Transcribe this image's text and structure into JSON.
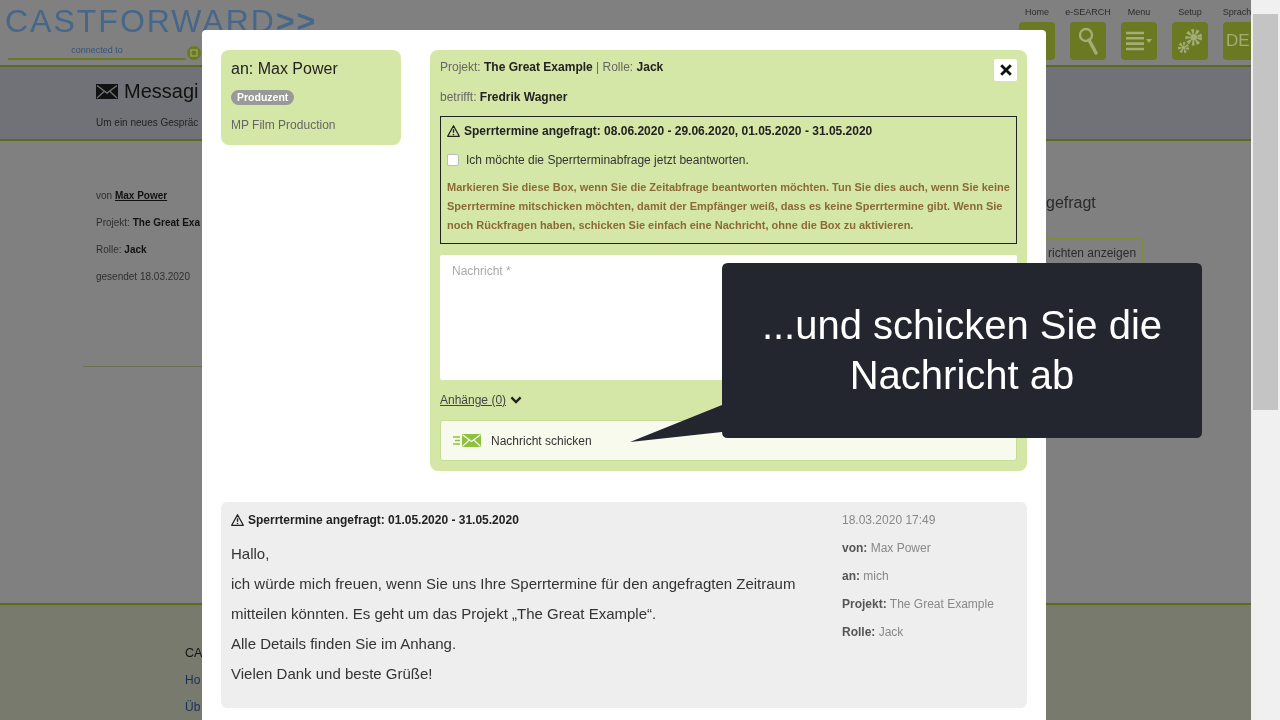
{
  "page": {
    "header": {
      "logo": "CASTFORWARD**>>**",
      "connected_to": "connected to",
      "nav": [
        {
          "label": "Home",
          "kind": "home"
        },
        {
          "label": "e-SEARCH",
          "kind": "search"
        },
        {
          "label": "Menu",
          "kind": "menu"
        },
        {
          "label": "Setup",
          "kind": "setup"
        },
        {
          "label": "Sprach",
          "kind": "language",
          "text": "DE"
        }
      ]
    },
    "title_band": {
      "title": "Messagi",
      "subtitle": "Um ein neues Gespräc"
    },
    "message_summary": {
      "from_label": "von",
      "from": "Max Power",
      "project": "Projekt: **The Great Exa**",
      "role": "Rolle: **Jack**",
      "sent": "gesendet 18.03.2020"
    },
    "side_panel": {
      "status": "gefragt",
      "button": "richten anzeigen"
    },
    "footer": {
      "lines": [
        {
          "text": "CA",
          "kind": "heading"
        },
        {
          "text": "Ho",
          "kind": "link"
        },
        {
          "text": "Üb",
          "kind": "link"
        }
      ]
    }
  },
  "modal": {
    "recipient": {
      "title": "an: Max Power",
      "badge": "Produzent",
      "company": "MP Film Production"
    },
    "compose": {
      "project_line": "Projekt: **The Great Example** | Rolle: **Jack**",
      "subject_line": "betrifft: **Fredrik Wagner**",
      "request": {
        "title": "Sperrtermine angefragt: 08.06.2020 - 29.06.2020, 01.05.2020 - 31.05.2020",
        "checkbox": {
          "label": "Ich möchte die Sperrterminabfrage jetzt beantworten.",
          "checked": false
        },
        "hint": "Markieren Sie diese Box, wenn Sie die Zeitabfrage beantworten möchten. Tun Sie dies auch, wenn Sie keine Sperrtermine mitschicken möchten, damit der Empfänger weiß, dass es keine Sperrtermine gibt. Wenn Sie noch Rückfragen haben, schicken Sie einfach eine Nachricht, ohne die Box zu aktivieren."
      },
      "message": {
        "placeholder": "Nachricht *"
      },
      "attachments": {
        "label": "Anhänge (0)",
        "expanded": false
      },
      "send_button": "Nachricht schicken"
    },
    "thread": [
      {
        "title": "Sperrtermine angefragt: 01.05.2020 - 31.05.2020",
        "body": [
          "Hallo,",
          "ich würde mich freuen, wenn Sie uns Ihre Sperrtermine für den angefragten Zeitraum mitteilen könnten. Es geht um das Projekt „The Great Example“.",
          "Alle Details finden Sie im Anhang.",
          "Vielen Dank und beste Grüße!"
        ],
        "date": "18.03.2020 17:49",
        "meta": [
          "**von:** Max Power",
          "**an:** mich",
          "**Projekt:** The Great Example",
          "**Rolle:** Jack"
        ]
      }
    ]
  },
  "callout": {
    "text": "...und schicken Sie die Nachricht ab"
  }
}
